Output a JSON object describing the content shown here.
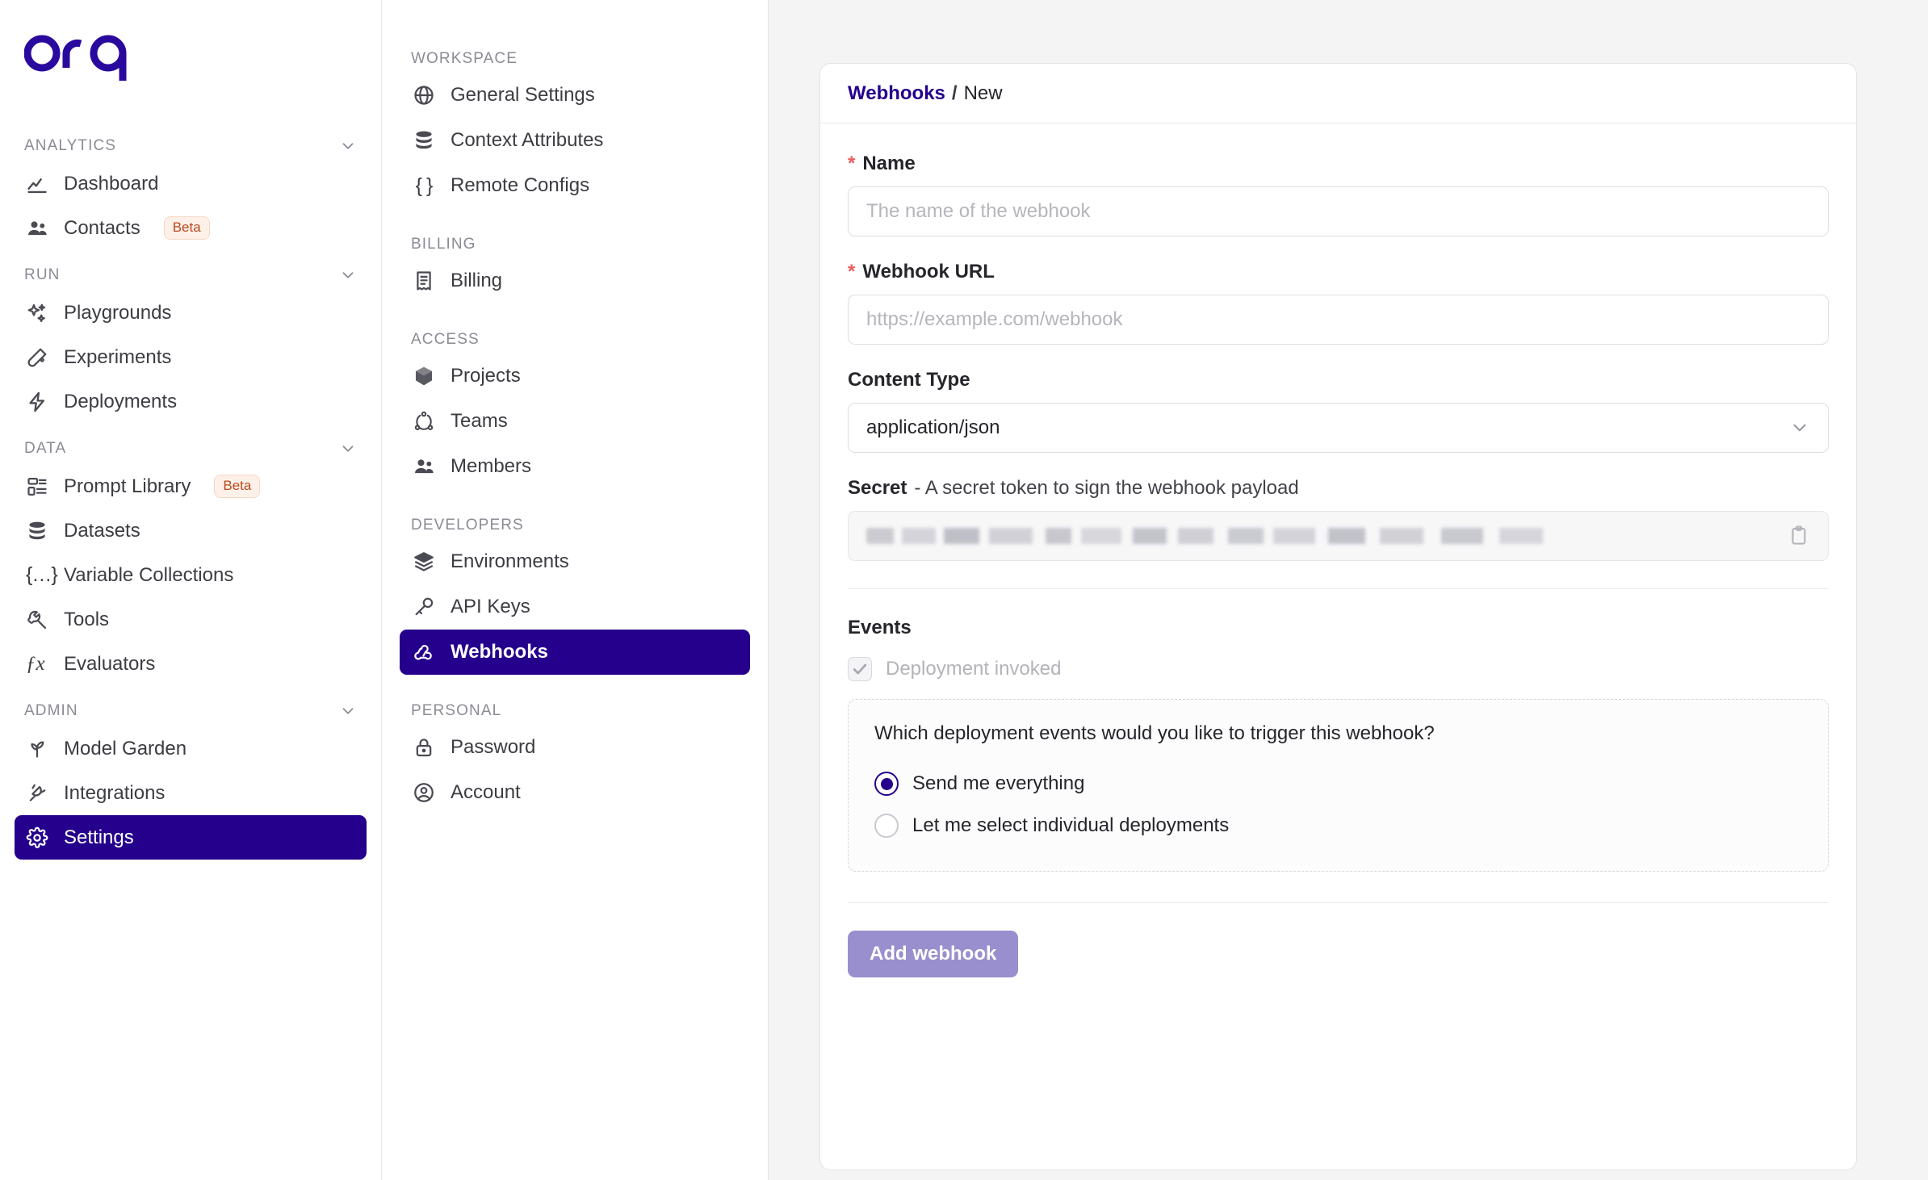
{
  "brand": {
    "logo_text": "orq",
    "logo_color": "#2a0a9e",
    "accent": "#24008c",
    "required_marker_color": "#ee5b5b",
    "beta_badge_color": "#b94a20"
  },
  "sidebar_primary": {
    "sections": [
      {
        "title": "ANALYTICS",
        "collapse_icon": "chevron-down-icon",
        "items": [
          {
            "label": "Dashboard",
            "icon": "chart-line-icon",
            "badge": "",
            "active": false
          },
          {
            "label": "Contacts",
            "icon": "users-icon",
            "badge": "Beta",
            "active": false
          }
        ]
      },
      {
        "title": "RUN",
        "collapse_icon": "chevron-down-icon",
        "items": [
          {
            "label": "Playgrounds",
            "icon": "sparkles-icon",
            "badge": "",
            "active": false
          },
          {
            "label": "Experiments",
            "icon": "test-tube-icon",
            "badge": "",
            "active": false
          },
          {
            "label": "Deployments",
            "icon": "bolt-icon",
            "badge": "",
            "active": false
          }
        ]
      },
      {
        "title": "DATA",
        "collapse_icon": "chevron-down-icon",
        "items": [
          {
            "label": "Prompt Library",
            "icon": "list-layout-icon",
            "badge": "Beta",
            "active": false
          },
          {
            "label": "Datasets",
            "icon": "database-icon",
            "badge": "",
            "active": false
          },
          {
            "label": "Variable Collections",
            "icon": "braces-icon",
            "badge": "",
            "active": false
          },
          {
            "label": "Tools",
            "icon": "wrench-icon",
            "badge": "",
            "active": false
          },
          {
            "label": "Evaluators",
            "icon": "fx-icon",
            "badge": "",
            "active": false
          }
        ]
      },
      {
        "title": "ADMIN",
        "collapse_icon": "chevron-down-icon",
        "items": [
          {
            "label": "Model Garden",
            "icon": "sprout-icon",
            "badge": "",
            "active": false
          },
          {
            "label": "Integrations",
            "icon": "plug-icon",
            "badge": "",
            "active": false
          },
          {
            "label": "Settings",
            "icon": "gear-icon",
            "badge": "",
            "active": true
          }
        ]
      }
    ]
  },
  "sidebar_secondary": {
    "sections": [
      {
        "title": "WORKSPACE",
        "items": [
          {
            "label": "General Settings",
            "icon": "globe-icon",
            "active": false
          },
          {
            "label": "Context Attributes",
            "icon": "database-icon",
            "active": false
          },
          {
            "label": "Remote Configs",
            "icon": "braces-icon",
            "active": false
          }
        ]
      },
      {
        "title": "BILLING",
        "items": [
          {
            "label": "Billing",
            "icon": "receipt-icon",
            "active": false
          }
        ]
      },
      {
        "title": "ACCESS",
        "items": [
          {
            "label": "Projects",
            "icon": "box-icon",
            "active": false
          },
          {
            "label": "Teams",
            "icon": "teams-icon",
            "active": false
          },
          {
            "label": "Members",
            "icon": "users-icon",
            "active": false
          }
        ]
      },
      {
        "title": "DEVELOPERS",
        "items": [
          {
            "label": "Environments",
            "icon": "layers-icon",
            "active": false
          },
          {
            "label": "API Keys",
            "icon": "key-icon",
            "active": false
          },
          {
            "label": "Webhooks",
            "icon": "webhook-icon",
            "active": true
          }
        ]
      },
      {
        "title": "PERSONAL",
        "items": [
          {
            "label": "Password",
            "icon": "lock-icon",
            "active": false
          },
          {
            "label": "Account",
            "icon": "user-circle-icon",
            "active": false
          }
        ]
      }
    ]
  },
  "main": {
    "breadcrumb": {
      "parent": "Webhooks",
      "separator": "/",
      "current": "New"
    },
    "form": {
      "name": {
        "label": "Name",
        "required_marker": "*",
        "value": "",
        "placeholder": "The name of the webhook"
      },
      "webhook_url": {
        "label": "Webhook URL",
        "required_marker": "*",
        "value": "",
        "placeholder": "https://example.com/webhook"
      },
      "content_type": {
        "label": "Content Type",
        "value": "application/json",
        "chevron_icon": "chevron-down-icon"
      },
      "secret": {
        "label": "Secret",
        "hint": "- A secret token to sign the webhook payload",
        "value_masked": true,
        "copy_icon": "clipboard-copy-icon"
      },
      "events": {
        "title": "Events",
        "checkbox": {
          "label": "Deployment invoked",
          "checked": true,
          "disabled": true
        },
        "question": "Which deployment events would you like to trigger this webhook?",
        "radios": [
          {
            "label": "Send me everything",
            "selected": true
          },
          {
            "label": "Let me select individual deployments",
            "selected": false
          }
        ]
      },
      "submit_button": {
        "label": "Add webhook",
        "disabled": true,
        "color": "#9a8fce"
      }
    }
  }
}
